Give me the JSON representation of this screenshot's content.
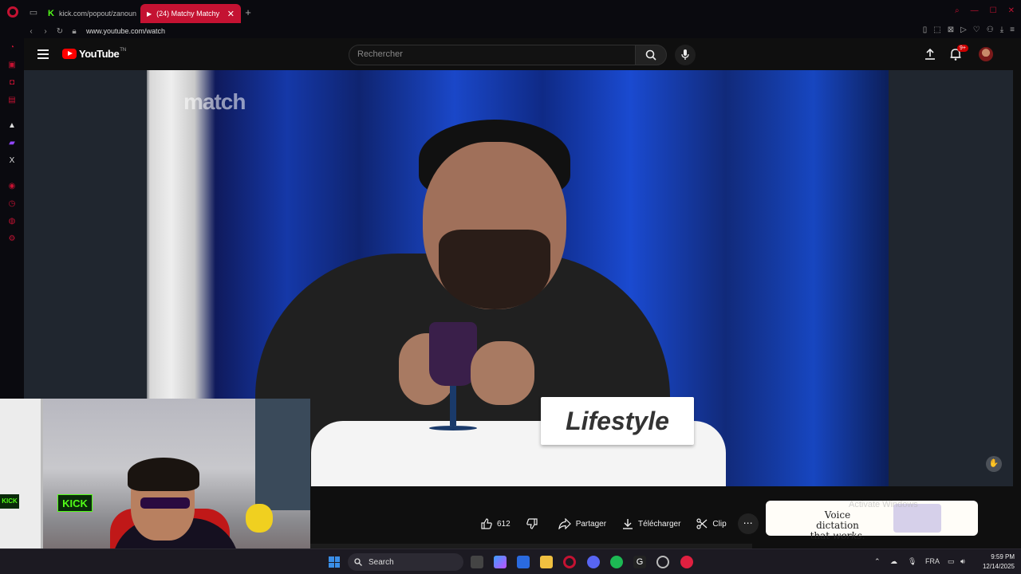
{
  "browser": {
    "tabs": [
      {
        "label": "kick.com/popout/zanoun",
        "icon": "kick-icon"
      },
      {
        "label": "(24) Matchy Matchy",
        "icon": "youtube-icon",
        "active": true
      }
    ],
    "url": "www.youtube.com/watch",
    "accent": "#c41232"
  },
  "youtube": {
    "logo_text": "YouTube",
    "logo_suffix": "TN",
    "search_placeholder": "Rechercher",
    "notification_badge": "9+"
  },
  "video": {
    "watermark": "match",
    "name_card": "Lifestyle"
  },
  "actions": {
    "likes": "612",
    "share": "Partager",
    "download": "Télécharger",
    "clip": "Clip"
  },
  "ad": {
    "line1": "Voice dictation",
    "line2": "that",
    "line2_em": "works."
  },
  "watermark": {
    "activate": "Activate Windows"
  },
  "taskbar": {
    "search": "Search",
    "lang": "FRA",
    "time": "9:59 PM",
    "date": "12/14/2025"
  }
}
